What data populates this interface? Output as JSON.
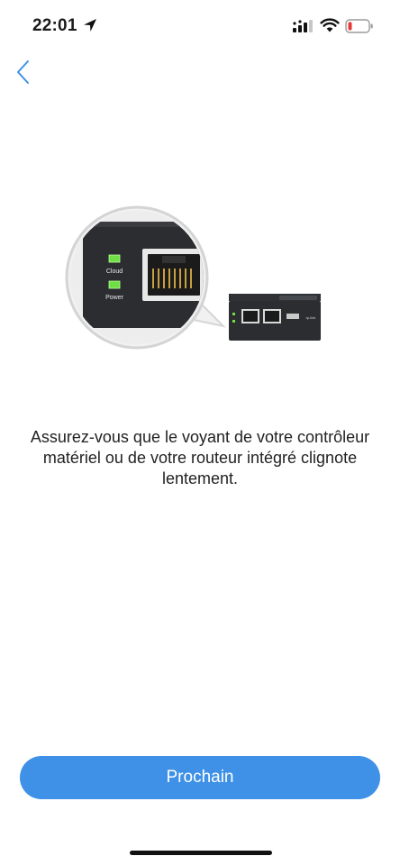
{
  "status_bar": {
    "time": "22:01"
  },
  "icons": {
    "location": "location-arrow-icon",
    "signal": "cellular-signal-icon",
    "wifi": "wifi-icon",
    "battery": "battery-low-icon",
    "back": "chevron-left-icon"
  },
  "colors": {
    "accent": "#3e91e6",
    "battery_low": "#e53935",
    "led_green": "#6ee043",
    "device_body": "#2b2d30"
  },
  "illustration": {
    "led_label_cloud": "Cloud",
    "led_label_power": "Power",
    "brand": "tp-link"
  },
  "main": {
    "instruction": "Assurez-vous que le voyant de votre contrôleur matériel ou de votre routeur intégré clignote lentement."
  },
  "footer": {
    "next_label": "Prochain"
  }
}
